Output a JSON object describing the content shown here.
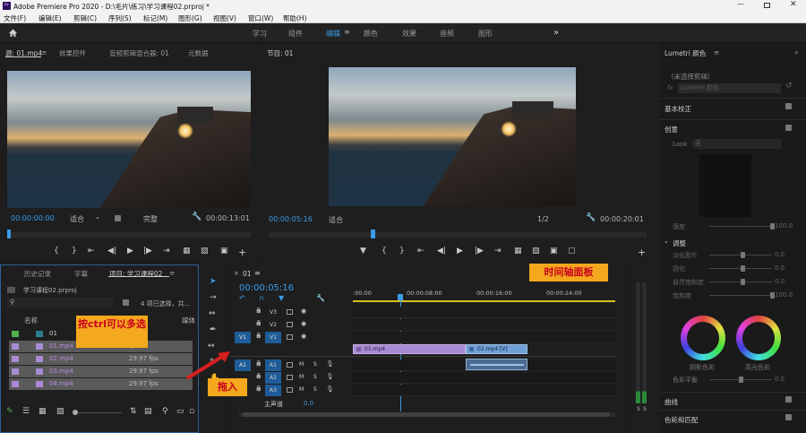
{
  "app": {
    "title": "Adobe Premiere Pro 2020 - D:\\毛片\\练习\\学习课程02.prproj *",
    "icon_text": "Pr"
  },
  "menu": [
    "文件(F)",
    "编辑(E)",
    "剪辑(C)",
    "序列(S)",
    "标记(M)",
    "图形(G)",
    "视图(V)",
    "窗口(W)",
    "帮助(H)"
  ],
  "workspaces": [
    "学习",
    "组件",
    "编辑",
    "颜色",
    "效果",
    "音频",
    "图形"
  ],
  "workspace_active": "编辑",
  "more_symbol": "»",
  "source": {
    "tabs": [
      "源: 01.mp4",
      "效果控件",
      "音频剪辑混合器: 01",
      "元数据"
    ],
    "timecode_in": "00:00:00:00",
    "fit": "适合",
    "quality": "完整",
    "timecode_out": "00:00:13:01"
  },
  "program": {
    "tab": "节目: 01",
    "timecode_in": "00:00:05:16",
    "fit": "适合",
    "quality": "1/2",
    "timecode_out": "00:00:20:01"
  },
  "project": {
    "tabs": [
      "历史记录",
      "字幕",
      "项目: 学习课程02"
    ],
    "file": "学习课程02.prproj",
    "selection": "4 项已选择，共...",
    "col_name": "名称",
    "col_fps": "帧率",
    "col_media": "媒体",
    "items": [
      {
        "name": "01",
        "fps": "fps",
        "color": "#52b04c"
      },
      {
        "name": "01.mp4",
        "fps": "fps",
        "color": "#a88bd3"
      },
      {
        "name": "02.mp4",
        "fps": "29.97 fps",
        "color": "#a88bd3"
      },
      {
        "name": "03.mp4",
        "fps": "29.97 fps",
        "color": "#a88bd3"
      },
      {
        "name": "04.mp4",
        "fps": "29.97 fps",
        "color": "#a88bd3"
      }
    ]
  },
  "timeline": {
    "seq_tab": "01",
    "timecode": "00:00:05:16",
    "ruler": [
      ":00:00",
      "00:00:08:00",
      "00:00:16:00",
      "00:00:24:00"
    ],
    "video_tracks": [
      "V3",
      "V2",
      "V1"
    ],
    "audio_tracks": [
      "A1",
      "A2",
      "A3"
    ],
    "source_patch": [
      "V1",
      "A1"
    ],
    "master": "主声道",
    "master_val": "0.0",
    "clips": [
      {
        "name": "01.mp4"
      },
      {
        "name": "02.mp4 [V]"
      }
    ],
    "m": "M",
    "s": "S"
  },
  "annotations": {
    "multiselect": "按ctrl可以多选",
    "drag": "拖入",
    "timeline_panel": "时间轴面板"
  },
  "lumetri": {
    "title": "Lumetri 颜色",
    "clip": "（未选择剪辑）",
    "fx": "fx",
    "fx_name": "Lumetri 颜色",
    "basic": "基本校正",
    "creative": "创意",
    "look_label": "Look",
    "look_value": "无",
    "intensity": "强度",
    "intensity_val": "100.0",
    "adjust": "调整",
    "sliders": [
      {
        "label": "淡化胶片",
        "val": "0.0"
      },
      {
        "label": "锐化",
        "val": "0.0"
      },
      {
        "label": "自然饱和度",
        "val": "0.0"
      },
      {
        "label": "饱和度",
        "val": "100.0"
      }
    ],
    "shadow_tint": "阴影色彩",
    "highlight_tint": "高光色彩",
    "tint_balance": "色彩平衡",
    "tint_balance_val": "0.0",
    "curves": "曲线",
    "hsl": "色轮和匹配"
  },
  "audio_meter": {
    "s1": "S",
    "s2": "S"
  },
  "colors": {
    "accent": "#3a9be8",
    "clip_video": "#a88bd3",
    "clip_audio": "#6f9fd5",
    "annotation_bg": "#f4a81d",
    "annotation_text": "#c8001e"
  }
}
